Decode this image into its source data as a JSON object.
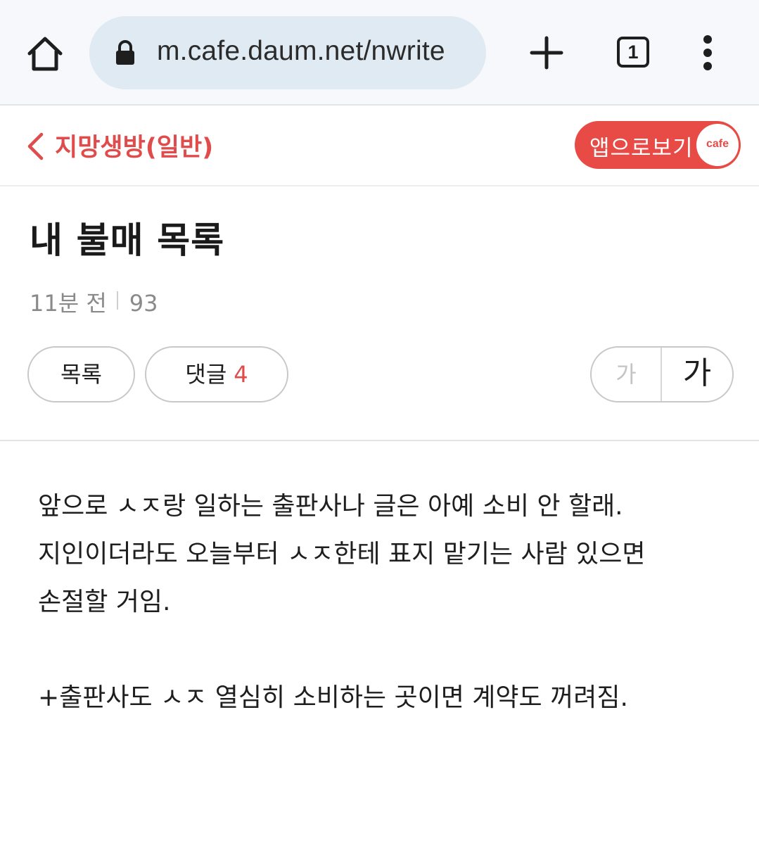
{
  "browser": {
    "url": "m.cafe.daum.net/nwrite",
    "tab_count": "1"
  },
  "cafe_header": {
    "cafe_name": "지망생방(일반)",
    "app_button_label": "앱으로보기",
    "logo_text": "cafe"
  },
  "post": {
    "title": "내 불매 목록",
    "time": "11분 전",
    "views": "93",
    "list_button": "목록",
    "comment_button": "댓글",
    "comment_count": "4",
    "font_small": "가",
    "font_large": "가",
    "body_lines": [
      "앞으로 ㅅㅈ랑 일하는 출판사나 글은 아예 소비 안 할래.",
      "지인이더라도 오늘부터 ㅅㅈ한테 표지 맡기는 사람 있으면",
      "손절할 거임.",
      "+출판사도 ㅅㅈ 열심히 소비하는 곳이면 계약도 꺼려짐."
    ]
  },
  "colors": {
    "accent": "#e84a45",
    "cafe_name": "#e04c4c",
    "chrome_bg": "#f7f8fb",
    "urlbar_bg": "#dfeaf2"
  }
}
